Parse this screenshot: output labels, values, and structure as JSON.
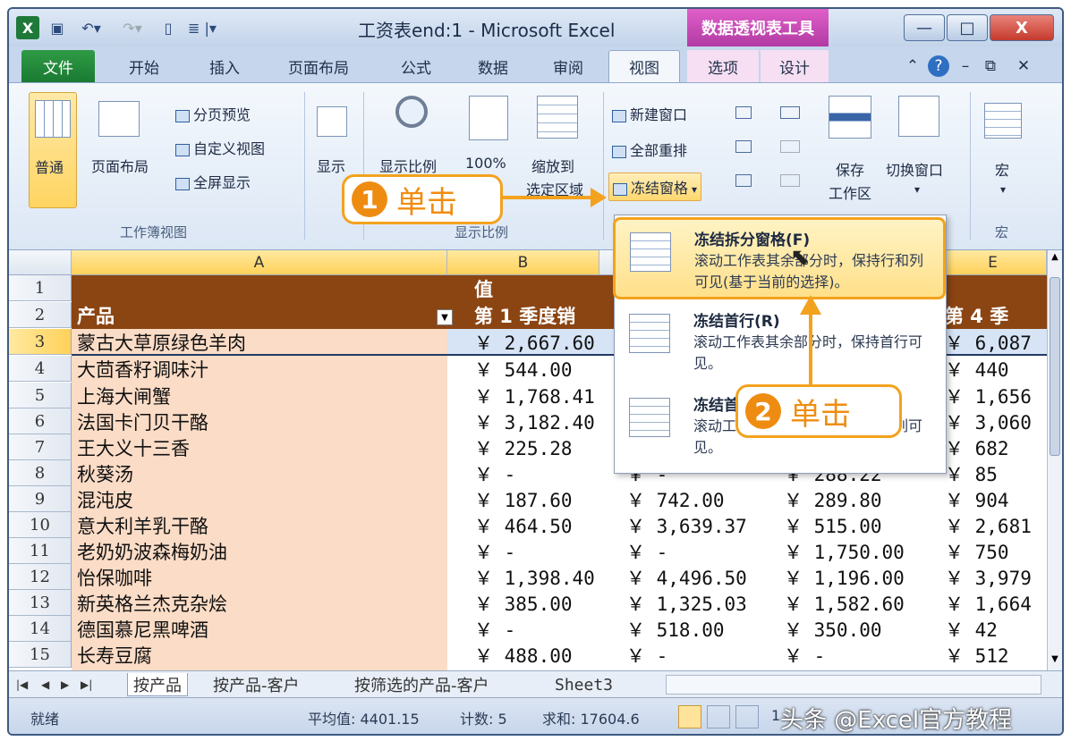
{
  "window": {
    "title": "工资表end:1 - Microsoft Excel",
    "context_tab_group": "数据透视表工具",
    "minimize": "—",
    "maximize": "□",
    "close": "X"
  },
  "quick_access": {
    "icons": [
      "excel-icon",
      "save-icon",
      "undo-icon",
      "redo-icon",
      "new-icon",
      "format-icon"
    ]
  },
  "tabs": [
    "文件",
    "开始",
    "插入",
    "页面布局",
    "公式",
    "数据",
    "审阅",
    "视图",
    "选项",
    "设计"
  ],
  "active_tab": "视图",
  "ribbon": {
    "workbook_views": {
      "normal": "普通",
      "page_layout": "页面布局",
      "page_break": "分页预览",
      "custom_views": "自定义视图",
      "full_screen": "全屏显示",
      "group": "工作簿视图"
    },
    "show": {
      "label": "显示"
    },
    "zoom": {
      "zoom": "显示比例",
      "hundred": "100%",
      "zoom_sel_1": "缩放到",
      "zoom_sel_2": "选定区域",
      "group": "显示比例"
    },
    "window": {
      "new_window": "新建窗口",
      "arrange_all": "全部重排",
      "freeze_panes": "冻结窗格",
      "save_workspace_1": "保存",
      "save_workspace_2": "工作区",
      "switch_windows": "切换窗口"
    },
    "macros": {
      "label": "宏",
      "group": "宏"
    }
  },
  "columns": [
    "A",
    "B",
    "E"
  ],
  "rows": [
    {
      "n": "1",
      "a": "",
      "b": "值",
      "e": ""
    },
    {
      "n": "2",
      "a": "产品",
      "b": "第 1 季度销",
      "e": "第 4 季"
    },
    {
      "n": "3",
      "a": "蒙古大草原绿色羊肉",
      "b": "￥ 2,667.60",
      "c": "",
      "d": "",
      "e": "￥ 6,087"
    },
    {
      "n": "4",
      "a": "大茴香籽调味汁",
      "b": "￥   544.00",
      "c": "",
      "d": "",
      "e": "￥   440"
    },
    {
      "n": "5",
      "a": "上海大闸蟹",
      "b": "￥ 1,768.41",
      "c": "",
      "d": "",
      "e": "￥ 1,656"
    },
    {
      "n": "6",
      "a": "法国卡门贝干酪",
      "b": "￥ 3,182.40",
      "c": "",
      "d": "",
      "e": "￥ 3,060"
    },
    {
      "n": "7",
      "a": "王大义十三香",
      "b": "￥   225.28",
      "c": "",
      "d": "",
      "e": "￥   682"
    },
    {
      "n": "8",
      "a": "秋葵汤",
      "b": "￥     -",
      "c": "￥        -",
      "d": "￥   288.22",
      "e": "￥    85"
    },
    {
      "n": "9",
      "a": "混沌皮",
      "b": "￥   187.60",
      "c": "￥   742.00",
      "d": "￥   289.80",
      "e": "￥   904"
    },
    {
      "n": "10",
      "a": "意大利羊乳干酪",
      "b": "￥   464.50",
      "c": "￥ 3,639.37",
      "d": "￥   515.00",
      "e": "￥ 2,681"
    },
    {
      "n": "11",
      "a": "老奶奶波森梅奶油",
      "b": "￥     -",
      "c": "￥        -",
      "d": "￥ 1,750.00",
      "e": "￥   750"
    },
    {
      "n": "12",
      "a": "怡保咖啡",
      "b": "￥ 1,398.40",
      "c": "￥ 4,496.50",
      "d": "￥ 1,196.00",
      "e": "￥ 3,979"
    },
    {
      "n": "13",
      "a": "新英格兰杰克杂烩",
      "b": "￥   385.00",
      "c": "￥ 1,325.03",
      "d": "￥ 1,582.60",
      "e": "￥ 1,664"
    },
    {
      "n": "14",
      "a": "德国慕尼黑啤酒",
      "b": "￥     -",
      "c": "￥   518.00",
      "d": "￥   350.00",
      "e": "￥    42"
    },
    {
      "n": "15",
      "a": "长寿豆腐",
      "b": "￥   488.00",
      "c": "￥        -",
      "d": "￥        -",
      "e": "￥   512"
    }
  ],
  "sheet_tabs": [
    "按产品",
    "按产品-客户",
    "按筛选的产品-客户",
    "Sheet3"
  ],
  "status": {
    "ready": "就绪",
    "average": "平均值: 4401.15",
    "count": "计数: 5",
    "sum": "求和: 17604.6",
    "zoom": "1"
  },
  "menu": {
    "items": [
      {
        "title": "冻结拆分窗格(F)",
        "desc": "滚动工作表其余部分时，保持行和列可见(基于当前的选择)。"
      },
      {
        "title": "冻结首行(R)",
        "desc": "滚动工作表其余部分时，保持首行可见。"
      },
      {
        "title": "冻结首列(C)",
        "desc": "滚动工作表其余部分时，保持首列可见。"
      }
    ]
  },
  "callouts": {
    "step1_num": "1",
    "step1_text": "单击",
    "step2_num": "2",
    "step2_text": "单击"
  },
  "watermark": "头条 @Excel官方教程",
  "colors": {
    "header_brown": "#8b4513",
    "row_fill": "#fbdcc6",
    "accent_orange": "#f3a21e",
    "file_green": "#1a7a32",
    "pivot_pink": "#c041b2"
  }
}
